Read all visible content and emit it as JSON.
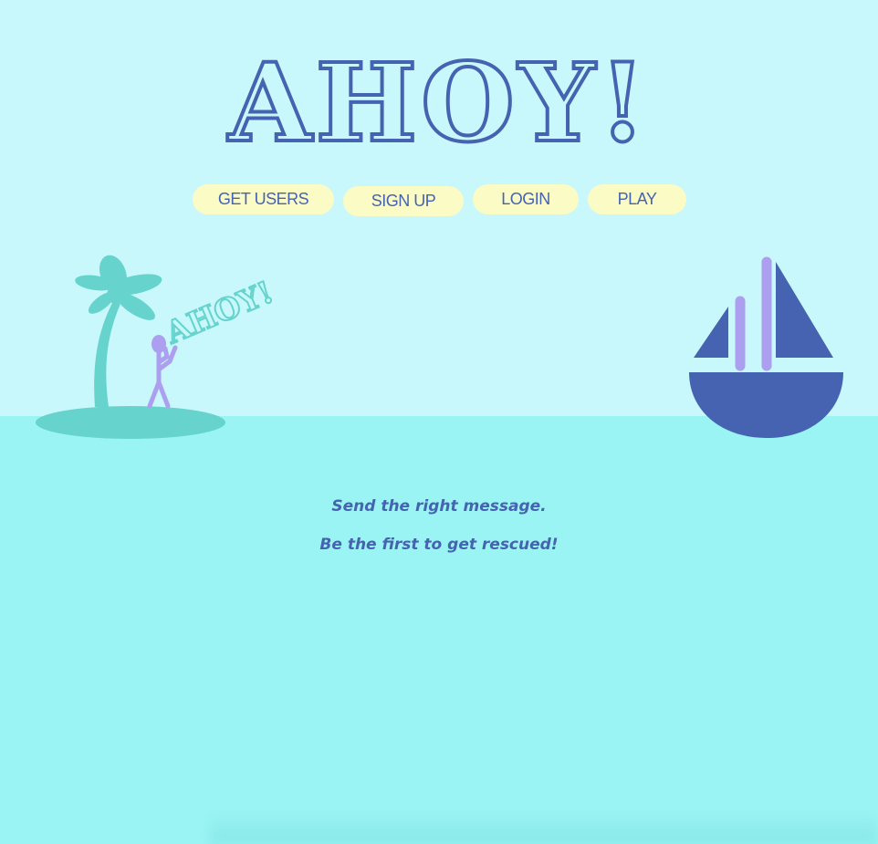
{
  "header": {
    "title": "AHOY!"
  },
  "nav": {
    "items": [
      {
        "label": "GET USERS"
      },
      {
        "label": "SIGN UP"
      },
      {
        "label": "LOGIN"
      },
      {
        "label": "PLAY"
      }
    ]
  },
  "scene": {
    "shout_text": "AHOY!"
  },
  "main": {
    "tagline_1": "Send the right message.",
    "tagline_2": "Be the first to get rescued!"
  },
  "colors": {
    "sky": "#c8f8fc",
    "sea": "#9af4f3",
    "accent_blue": "#4563b0",
    "island_teal": "#66d3cd",
    "figure_lavender": "#ad9ff0",
    "button_yellow": "#fbfbc6"
  }
}
